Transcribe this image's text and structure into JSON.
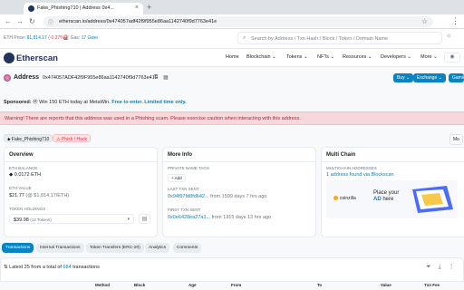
{
  "browser": {
    "tab_title": "Fake_Phishing710 | Address 0x4...",
    "url": "etherscan.io/address/0x474057adf42f9f955e86aa1142740f9d7763e41e",
    "new_tab_glyph": "+",
    "close_tab_glyph": "×",
    "back_glyph": "←",
    "forward_glyph": "→",
    "reload_glyph": "↻",
    "menu_glyph": "⋮",
    "star_glyph": "☆",
    "lock_glyph": "ⓘ"
  },
  "infobar": {
    "eth_price_label": "ETH Price:",
    "eth_price": "$1,814.17",
    "eth_change": "(-0.27%)",
    "gas_label": "Gas:",
    "gas_value": "17 Gwei",
    "search_placeholder": "Search by Address / Txn Hash / Block / Token / Domain Name",
    "theme_glyph": "☼"
  },
  "header": {
    "logo": "Etherscan",
    "nav": [
      "Home",
      "Blockchain",
      "Tokens",
      "NFTs",
      "Resources",
      "Developers",
      "More"
    ],
    "chevron": "⌄"
  },
  "address": {
    "label": "Address",
    "value": "0x474057ADF42f9F955e86aa1142740f9d7763e41E",
    "buttons": [
      "Buy",
      "Exchange",
      "Gaming"
    ]
  },
  "sponsored": {
    "label": "Sponsored:",
    "text": "Win 150 ETH today at MetaWin.",
    "cta": "Free to enter. Limited time only."
  },
  "warning": {
    "text": "Warning! There are reports that this address was used in a Phishing scam. Please exercise caution when interacting with this address."
  },
  "tags": {
    "name_tag": "Fake_Phishing710",
    "phish_tag": "Phish / Hack",
    "more": "Mo"
  },
  "overview": {
    "title": "Overview",
    "eth_balance_label": "ETH BALANCE",
    "eth_balance": "0.0172 ETH",
    "eth_value_label": "ETH VALUE",
    "eth_value": "$21.77",
    "eth_value_rate": "(@ $1,814.17/ETH)",
    "holdings_label": "TOKEN HOLDINGS",
    "holdings_value": "$39.98",
    "holdings_count": "(12 Tokens)"
  },
  "more_info": {
    "title": "More Info",
    "private_tags_label": "PRIVATE NAME TAGS",
    "add_label": "+ Add",
    "last_txn_label": "LAST TXN SENT",
    "last_txn_hash": "0x94f97fd8fd642...",
    "last_txn_time": "from 1599 days 7 hrs ago",
    "first_txn_label": "FIRST TXN SENT",
    "first_txn_hash": "0x0e6428ea27a1...",
    "first_txn_time": "from 1915 days 13 hrs ago"
  },
  "multichain": {
    "title": "Multi Chain",
    "addresses_label": "MULTICHAIN ADDRESSES",
    "addresses_value": "1 address found via Blockscan",
    "ad_brand": "coinzilla",
    "ad_text_1": "Place your",
    "ad_text_2": "AD",
    "ad_text_3": "here"
  },
  "tabs": [
    "Transactions",
    "Internal Transactions",
    "Token Transfers (ERC-20)",
    "Analytics",
    "Comments"
  ],
  "transactions": {
    "summary_prefix": "Latest 25 from a total of",
    "summary_count": "684",
    "summary_suffix": "transactions",
    "columns": [
      "Method",
      "Block",
      "Age",
      "From",
      "To",
      "Value",
      "Txn Fee"
    ]
  },
  "colors": {
    "primary": "#0784c3",
    "danger": "#dc3545",
    "logo_navy": "#21325b"
  }
}
